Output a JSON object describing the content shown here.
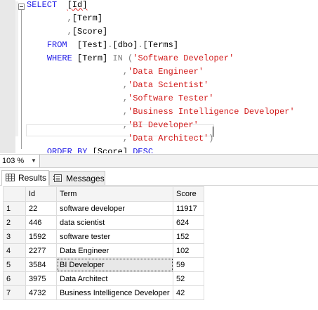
{
  "editor": {
    "lines": [
      [
        [
          "kw",
          "SELECT"
        ],
        [
          "t",
          "  "
        ],
        [
          "sq",
          "[Id]"
        ]
      ],
      [
        [
          "t",
          "        "
        ],
        [
          "pu",
          ","
        ],
        [
          "t",
          "[Term]"
        ]
      ],
      [
        [
          "t",
          "        "
        ],
        [
          "pu",
          ","
        ],
        [
          "t",
          "[Score]"
        ]
      ],
      [
        [
          "t",
          "    "
        ],
        [
          "kw",
          "FROM"
        ],
        [
          "t",
          "  [Test]"
        ],
        [
          "pu",
          "."
        ],
        [
          "t",
          "[dbo]"
        ],
        [
          "pu",
          "."
        ],
        [
          "t",
          "[Terms]"
        ]
      ],
      [
        [
          "t",
          "    "
        ],
        [
          "kw",
          "WHERE"
        ],
        [
          "t",
          " [Term] "
        ],
        [
          "pu",
          "IN"
        ],
        [
          "t",
          " "
        ],
        [
          "pu",
          "("
        ],
        [
          "str",
          "'Software Developer'"
        ]
      ],
      [
        [
          "t",
          "                   "
        ],
        [
          "pu",
          ","
        ],
        [
          "str",
          "'Data Engineer'"
        ]
      ],
      [
        [
          "t",
          "                   "
        ],
        [
          "pu",
          ","
        ],
        [
          "str",
          "'Data Scientist'"
        ]
      ],
      [
        [
          "t",
          "                   "
        ],
        [
          "pu",
          ","
        ],
        [
          "str",
          "'Software Tester'"
        ]
      ],
      [
        [
          "t",
          "                   "
        ],
        [
          "pu",
          ","
        ],
        [
          "str",
          "'Business Intelligence Developer'"
        ]
      ],
      [
        [
          "t",
          "                   "
        ],
        [
          "pu",
          ","
        ],
        [
          "str",
          "'BI Developer'"
        ]
      ],
      [
        [
          "t",
          "                   "
        ],
        [
          "pu",
          ","
        ],
        [
          "str",
          "'Data Architect'"
        ],
        [
          "pu",
          ")"
        ]
      ],
      [
        [
          "t",
          "    "
        ],
        [
          "kw",
          "ORDER BY"
        ],
        [
          "t",
          " [Score] "
        ],
        [
          "kw",
          "DESC"
        ]
      ]
    ]
  },
  "zoom": {
    "value": "103 %"
  },
  "tabs": [
    {
      "label": "Results",
      "active": true
    },
    {
      "label": "Messages",
      "active": false
    }
  ],
  "grid": {
    "columns": [
      "Id",
      "Term",
      "Score"
    ],
    "rows": [
      {
        "n": "1",
        "id": "22",
        "term": "software developer",
        "score": "11917"
      },
      {
        "n": "2",
        "id": "446",
        "term": "data scientist",
        "score": "624"
      },
      {
        "n": "3",
        "id": "1592",
        "term": "software tester",
        "score": "152"
      },
      {
        "n": "4",
        "id": "2277",
        "term": "Data Engineer",
        "score": "102"
      },
      {
        "n": "5",
        "id": "3584",
        "term": "BI Developer",
        "score": "59"
      },
      {
        "n": "6",
        "id": "3975",
        "term": "Data Architect",
        "score": "52"
      },
      {
        "n": "7",
        "id": "4732",
        "term": "Business Intelligence Developer",
        "score": "42"
      }
    ],
    "selected_cell": {
      "row": 4,
      "col": "term"
    }
  }
}
